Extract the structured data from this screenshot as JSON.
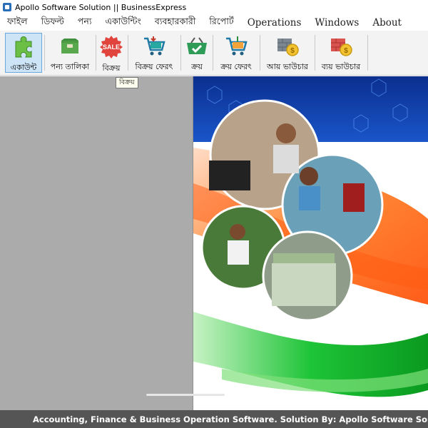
{
  "window": {
    "title": "Apollo Software Solution  ||  BusinessExpress"
  },
  "menu": [
    {
      "label": "ফাইল",
      "latin": false
    },
    {
      "label": "ডিফল্ট",
      "latin": false
    },
    {
      "label": "পন্য",
      "latin": false
    },
    {
      "label": "একাউন্টিং",
      "latin": false
    },
    {
      "label": "ব্যবহারকারী",
      "latin": false
    },
    {
      "label": "রিপোর্ট",
      "latin": false
    },
    {
      "label": "Operations",
      "latin": true
    },
    {
      "label": "Windows",
      "latin": true
    },
    {
      "label": "About",
      "latin": true
    }
  ],
  "toolbar": {
    "buttons": [
      {
        "label": "একাউন্ট",
        "icon": "puzzle-icon",
        "active": true
      },
      {
        "label": "পন্য তালিকা",
        "icon": "product-box-icon",
        "active": false
      },
      {
        "label": "বিক্রয়",
        "icon": "sale-badge-icon",
        "active": false
      },
      {
        "label": "বিক্রয় ফেরৎ",
        "icon": "sales-return-cart-icon",
        "active": false
      },
      {
        "label": "ক্রয়",
        "icon": "purchase-basket-icon",
        "active": false
      },
      {
        "label": "ক্রয় ফেরৎ",
        "icon": "purchase-return-cart-icon",
        "active": false
      },
      {
        "label": "আয় ভাউচার",
        "icon": "income-voucher-icon",
        "active": false
      },
      {
        "label": "ব্যয় ভাউচার",
        "icon": "expense-voucher-icon",
        "active": false
      }
    ],
    "sale_badge_text": "SALE"
  },
  "tooltip": {
    "text": "বিক্রয়"
  },
  "banner": {
    "description_icon": "business-collage-banner"
  },
  "statusbar": {
    "text": "Accounting, Finance & Business Operation Software.   Solution By: Apollo Software Solution"
  },
  "colors": {
    "left_panel": "#ababab",
    "statusbar": "#555555",
    "active_button": "#cde4f7"
  }
}
